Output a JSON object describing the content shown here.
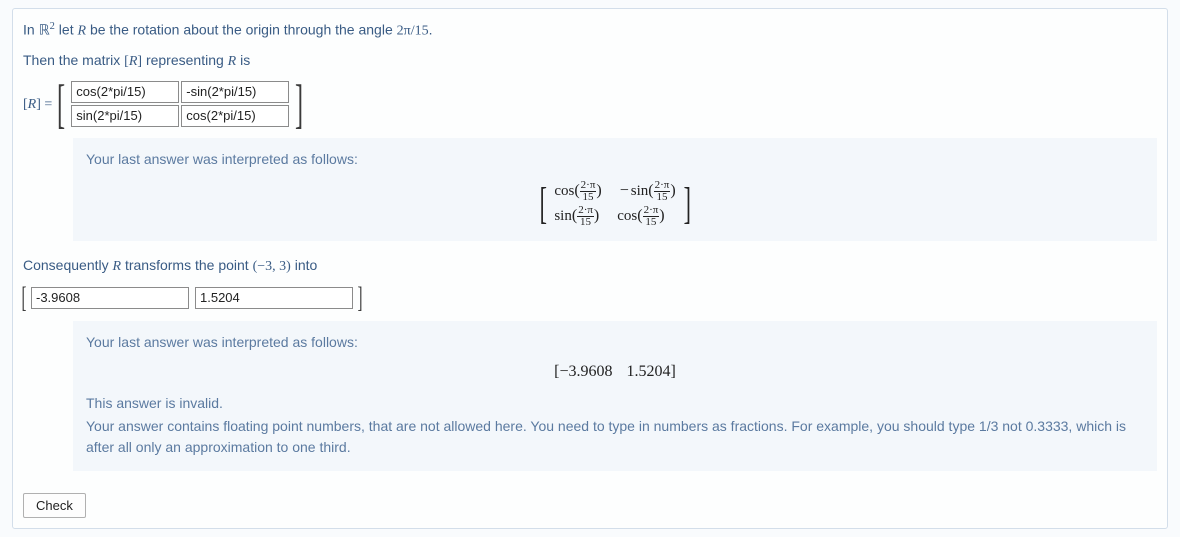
{
  "q1": {
    "line1_a": "In ",
    "line1_space": "ℝ",
    "line1_exp": "2",
    "line1_b": " let ",
    "line1_R": "R",
    "line1_c": " be the rotation about the origin through the angle ",
    "line1_angle": "2π/15",
    "line1_d": "."
  },
  "q2": {
    "a": "Then the matrix ",
    "br_l": "[",
    "R": "R",
    "br_r": "]",
    "b": " representing ",
    "R2": "R",
    "c": " is"
  },
  "lhs": {
    "br_l": "[",
    "R": "R",
    "br_r": "]",
    "eq": " ="
  },
  "matrix": {
    "r0c0": "cos(2*pi/15)",
    "r0c1": "-sin(2*pi/15)",
    "r1c0": "sin(2*pi/15)",
    "r1c1": "cos(2*pi/15)"
  },
  "fb1": {
    "head": "Your last answer was interpreted as follows:",
    "cos": "cos",
    "sin": "sin",
    "neg": "−",
    "num": "2·π",
    "den": "15"
  },
  "q3": {
    "a": "Consequently ",
    "R": "R",
    "b": " transforms the point ",
    "pt": "(−3, 3)",
    "c": " into"
  },
  "vector": {
    "x": "-3.9608",
    "y": "1.5204"
  },
  "fb2": {
    "head": "Your last answer was interpreted as follows:",
    "disp_x": "−3.9608",
    "disp_y": "1.5204",
    "invalid": "This answer is invalid.",
    "msg": "Your answer contains floating point numbers, that are not allowed here. You need to type in numbers as fractions. For example, you should type 1/3 not 0.3333, which is after all only an approximation to one third."
  },
  "check_label": "Check"
}
